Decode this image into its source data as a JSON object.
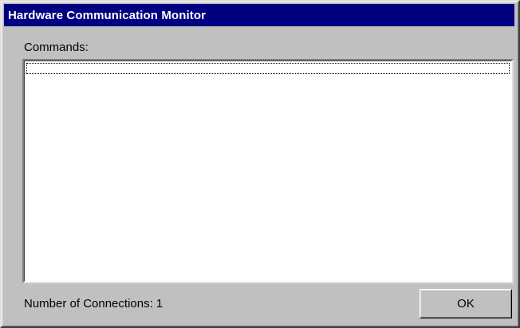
{
  "window": {
    "title": "Hardware Communication Monitor",
    "title_bar_color": "#000080"
  },
  "commands": {
    "label": "Commands:",
    "items": []
  },
  "footer": {
    "connections_label": "Number of Connections: 1",
    "ok_label": "OK"
  }
}
